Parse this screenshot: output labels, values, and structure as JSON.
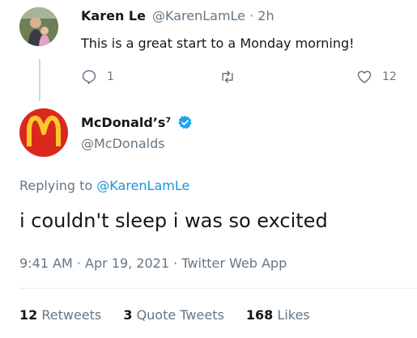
{
  "parent_tweet": {
    "author_name": "Karen Le",
    "handle_time": "@KarenLamLe · 2h",
    "text": "This is a great start to a Monday morning!",
    "reply_count": "1",
    "like_count": "12",
    "icons": {
      "reply": "reply-icon",
      "retweet": "retweet-icon",
      "like": "heart-icon"
    }
  },
  "main_tweet": {
    "author_name": "McDonald’s⁷",
    "handle": "@McDonalds",
    "replying_prefix": "Replying to ",
    "replying_to": "@KarenLamLe",
    "text": "i couldn't sleep i was so excited",
    "meta": "9:41 AM · Apr 19, 2021 · Twitter Web App",
    "stats": {
      "retweets_count": "12",
      "retweets_label": " Retweets",
      "quotes_count": "3",
      "quotes_label": " Quote Tweets",
      "likes_count": "168",
      "likes_label": " Likes"
    }
  },
  "colors": {
    "brand_red": "#da291c",
    "arches_yellow": "#ffc72c",
    "verified_blue": "#1da1f2",
    "link_blue": "#1b95e0",
    "muted_gray": "#657786"
  }
}
